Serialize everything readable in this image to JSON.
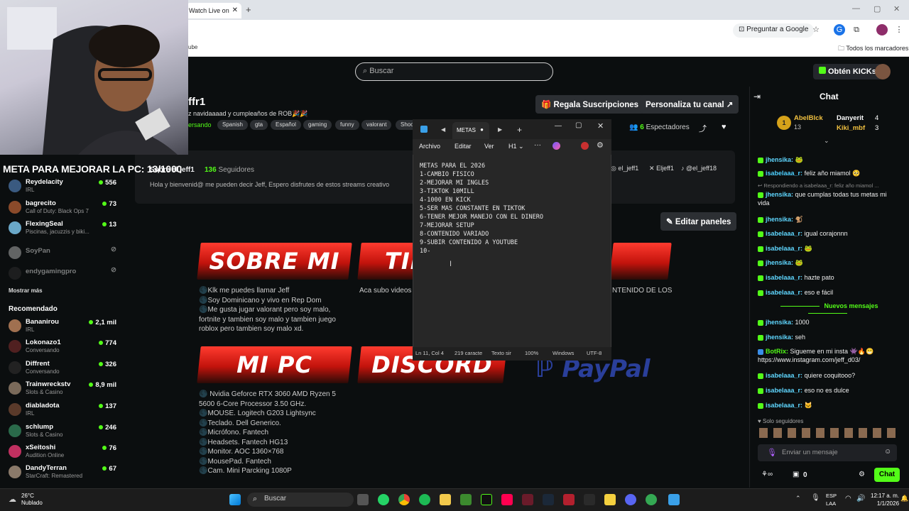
{
  "browser": {
    "tab_title": "Watch Live on",
    "tab_close": "✕",
    "new_tab": "+",
    "ask_google": "Preguntar a Google",
    "all_bookmarks": "Todos los marcadores",
    "bookmark_fragment": "ube"
  },
  "kick": {
    "search_placeholder": "Buscar",
    "get_kicks": "Obtén KICKs",
    "channel_name": "ffr1",
    "stream_title": "z navidaaaad y cumpleaños de ROB🎉🎉",
    "category_fragment": "ersando",
    "tags": [
      "Spanish",
      "gta",
      "Español",
      "gaming",
      "funny",
      "valorant",
      "Shoo"
    ],
    "gift_subs": "Regala Suscripciones",
    "customize": "Personaliza tu canal",
    "viewers_count": "6",
    "viewers_label": "Espectadores",
    "followers_count": "136",
    "followers_label": "Seguidores",
    "about_name_fragment": "Sobre el jeff1",
    "about_text": "Hola y bienvenid@ me pueden decir Jeff, Espero disfrutes de estos streams creativo",
    "socials": [
      "el_jeff1",
      "Eljeff1",
      "@el_jeff18"
    ],
    "edit_panels": "Editar paneles",
    "panels": [
      {
        "title": "SOBRE MI",
        "text": [
          "🌑Klk me puedes llamar Jeff",
          "🌑Soy Dominicano y vivo en Rep Dom",
          "🌑Me gusta jugar valorant pero soy malo, fortnite y tambien soy malo y tambien juego roblox pero tambien soy malo xd."
        ]
      },
      {
        "title": "TIK",
        "text": [
          "Aca subo videos"
        ]
      },
      {
        "title": "",
        "text": [
          "NTENIDO DE LOS"
        ]
      },
      {
        "title": "MI PC",
        "text": [
          "🌑 Nvidia Geforce RTX 3060 AMD Ryzen 5 5600 6-Core Processor 3.50 GHz.",
          "🌑MOUSE. Logitech G203 Lightsync",
          "🌑Teclado. Dell Generico.",
          "🌑Micrófono. Fantech",
          "🌑Headsets. Fantech HG13",
          "🌑Monitor. AOC 1360×768",
          "🌑MousePad. Fantech",
          "🌑Cam. Mini Parcking 1080P"
        ]
      },
      {
        "title": "DISCORD",
        "text": []
      }
    ],
    "paypal": "PayPal"
  },
  "overlay": {
    "goal_text": "META PARA MEJORAR LA PC: 13/1000"
  },
  "sidebar": {
    "following": [
      {
        "name": "Reydelacity",
        "cat": "IRL",
        "count": "556"
      },
      {
        "name": "bagrecito",
        "cat": "Call of Duty: Black Ops 7",
        "count": "73"
      },
      {
        "name": "FlexingSeal",
        "cat": "Piscinas, jacuzzis y biki...",
        "count": "13"
      },
      {
        "name": "SoyPan",
        "cat": "",
        "count": ""
      },
      {
        "name": "endygamingpro",
        "cat": "",
        "count": ""
      }
    ],
    "show_more": "Mostrar más",
    "recommended_label": "Recomendado",
    "recommended": [
      {
        "name": "Bananirou",
        "cat": "IRL",
        "count": "2,1 mil"
      },
      {
        "name": "Lokonazo1",
        "cat": "Conversando",
        "count": "774"
      },
      {
        "name": "Diffrent",
        "cat": "Conversando",
        "count": "326"
      },
      {
        "name": "Trainwreckstv",
        "cat": "Slots & Casino",
        "count": "8,9 mil"
      },
      {
        "name": "diabladota",
        "cat": "IRL",
        "count": "137"
      },
      {
        "name": "schlump",
        "cat": "Slots & Casino",
        "count": "246"
      },
      {
        "name": "xSeitoshi",
        "cat": "Audition Online",
        "count": "76"
      },
      {
        "name": "DandyTerran",
        "cat": "StarCraft: Remastered",
        "count": "67"
      }
    ]
  },
  "notepad": {
    "tab_title": "METAS",
    "menu": [
      "Archivo",
      "Editar",
      "Ver"
    ],
    "heading": "H1",
    "lines": "METAS PARA EL 2026\n1-CAMBIO FISICO\n2-MEJORAR MI INGLES\n3-TIKTOK 10MILL\n4-1000 EN KICK\n5-SER MAS CONSTANTE EN TIKTOK\n6-TENER MEJOR MANEJO CON EL DINERO\n7-MEJORAR SETUP\n8-CONTENIDO VARIADO\n9-SUBIR CONTENIDO A YOUTUBE\n10-",
    "status": [
      "Ln 11, Col 4",
      "219 caracte",
      "Texto sir",
      "100%",
      "Windows",
      "UTF-8"
    ]
  },
  "chat": {
    "title": "Chat",
    "top_gifters": [
      {
        "name": "AbelBlck",
        "count": "13"
      },
      {
        "name": "Danyerit",
        "count": "4"
      },
      {
        "name": "Kiki_mbf",
        "count": "3"
      }
    ],
    "messages": [
      {
        "user": "jhensika:",
        "text": "🐸"
      },
      {
        "user": "isabelaaa_r:",
        "text": "feliz año miamol 🥺"
      },
      {
        "user": "",
        "text": "Respondiendo a isabelaaa_r: feliz año miamol ..."
      },
      {
        "user": "jhensika:",
        "text": "que cumplas todas tus metas mi vida"
      },
      {
        "user": "jhensika:",
        "text": "🐒"
      },
      {
        "user": "isabelaaa_r:",
        "text": "igual corajonnn"
      },
      {
        "user": "isabelaaa_r:",
        "text": "🐸"
      },
      {
        "user": "jhensika:",
        "text": "🐸"
      },
      {
        "user": "isabelaaa_r:",
        "text": "hazte pato"
      },
      {
        "user": "isabelaaa_r:",
        "text": "eso e fácil"
      }
    ],
    "new_messages": "Nuevos mensajes",
    "messages2": [
      {
        "user": "jhensika:",
        "text": "1000"
      },
      {
        "user": "jhensika:",
        "text": "seh"
      },
      {
        "user": "BotRix:",
        "text": "Sigueme en mi insta 👾🔥😁 https://www.instagram.com/jeff_d03/"
      },
      {
        "user": "isabelaaa_r:",
        "text": "quiere coquitooo?"
      },
      {
        "user": "isabelaaa_r:",
        "text": "eso no es dulce"
      },
      {
        "user": "isabelaaa_r:",
        "text": "🐱"
      }
    ],
    "followers_only": "Solo seguidores",
    "input_placeholder": "Enviar un mensaje",
    "points": "0",
    "send": "Chat"
  },
  "taskbar": {
    "weather_temp": "26°C",
    "weather_desc": "Nublado",
    "search": "Buscar",
    "lang1": "ESP",
    "lang2": "LAA",
    "time": "12:17 a. m.",
    "date": "1/1/2026"
  }
}
